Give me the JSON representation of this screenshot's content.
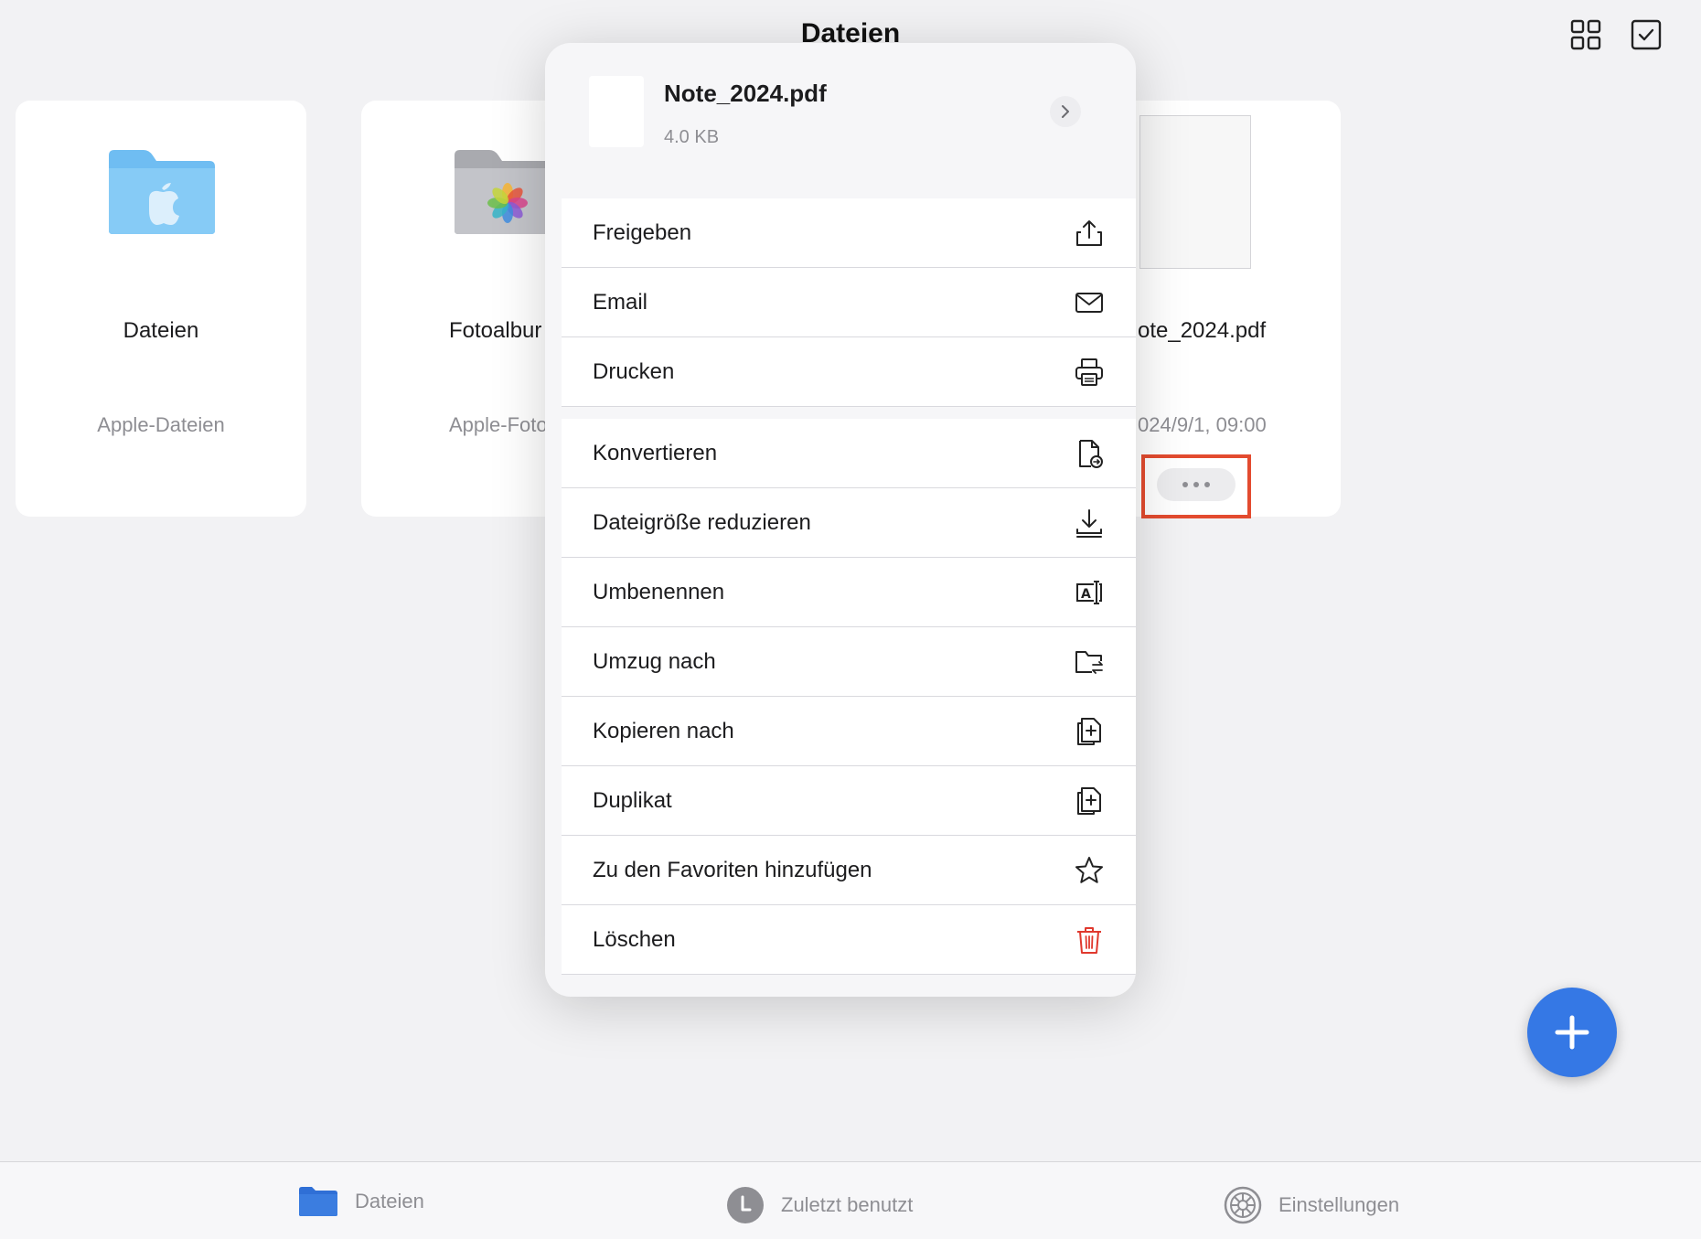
{
  "header": {
    "title": "Dateien",
    "grid_icon": "grid-view-icon",
    "select_icon": "checkbox-select-icon"
  },
  "files": [
    {
      "name": "Dateien",
      "subtitle": "Apple-Dateien",
      "icon": "apple-folder-icon",
      "color": "#6fbdf2"
    },
    {
      "name": "Fotoalbur",
      "subtitle": "Apple-Foto",
      "icon": "photos-folder-icon",
      "color": "#b7b8bd"
    },
    {
      "name": "ote_2024.pdf",
      "subtitle": "024/9/1, 09:00",
      "icon": "pdf-thumbnail"
    }
  ],
  "menu": {
    "file_name": "Note_2024.pdf",
    "file_size": "4.0 KB",
    "group1": [
      {
        "label": "Freigeben",
        "icon": "share-icon"
      },
      {
        "label": "Email",
        "icon": "mail-icon"
      },
      {
        "label": "Drucken",
        "icon": "printer-icon"
      }
    ],
    "group2": [
      {
        "label": "Konvertieren",
        "icon": "convert-file-icon"
      },
      {
        "label": "Dateigröße reduzieren",
        "icon": "download-icon"
      },
      {
        "label": "Umbenennen",
        "icon": "rename-icon"
      },
      {
        "label": "Umzug nach",
        "icon": "move-folder-icon"
      },
      {
        "label": "Kopieren nach",
        "icon": "copy-icon"
      },
      {
        "label": "Duplikat",
        "icon": "duplicate-icon"
      },
      {
        "label": "Zu den Favoriten hinzufügen",
        "icon": "star-icon"
      },
      {
        "label": "Löschen",
        "icon": "trash-icon",
        "color": "#e0392e"
      }
    ]
  },
  "tabs": [
    {
      "label": "Dateien",
      "icon": "folder-icon",
      "color": "#2f6fd6"
    },
    {
      "label": "Zuletzt benutzt",
      "icon": "clock-icon"
    },
    {
      "label": "Einstellungen",
      "icon": "gear-icon"
    }
  ],
  "colors": {
    "accent": "#3578e5",
    "highlight": "#e34b2f",
    "delete": "#e0392e"
  }
}
